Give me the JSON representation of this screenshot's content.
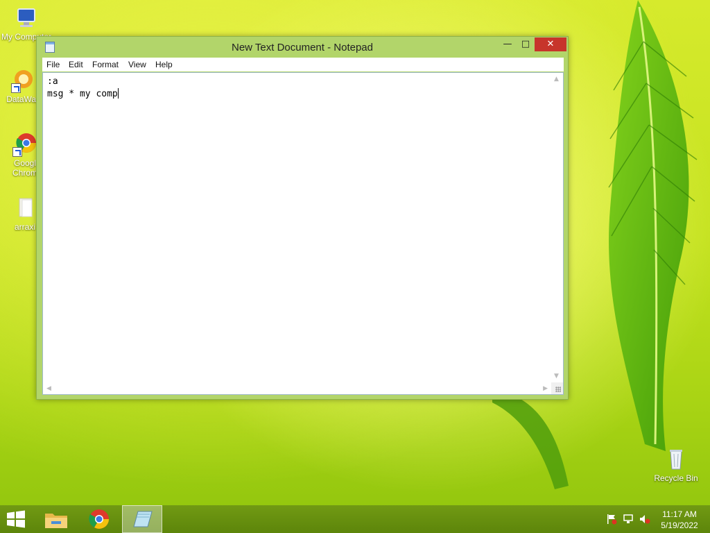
{
  "desktop": {
    "icons": [
      {
        "label": "My Computer",
        "icon": "computer-icon"
      },
      {
        "label": "DataWag",
        "icon": "datawag-shortcut-icon"
      },
      {
        "label": "Googl Chrom",
        "label_line1": "Googl",
        "label_line2": "Chrom",
        "icon": "chrome-shortcut-icon"
      },
      {
        "label": "arraxi",
        "icon": "folder-icon"
      },
      {
        "label": "Recycle Bin",
        "icon": "recycle-bin-icon"
      }
    ]
  },
  "window": {
    "title": "New Text Document - Notepad",
    "controls": {
      "minimize": "—",
      "maximize": "□",
      "close": "✕"
    },
    "menu": [
      "File",
      "Edit",
      "Format",
      "View",
      "Help"
    ],
    "content_lines": [
      ":a",
      "msg * my comp"
    ],
    "accent_color": "#b2d56a"
  },
  "taskbar": {
    "pinned": [
      {
        "name": "start-button",
        "icon": "windows-logo-icon"
      },
      {
        "name": "file-explorer",
        "icon": "folder-icon"
      },
      {
        "name": "google-chrome",
        "icon": "chrome-icon"
      },
      {
        "name": "notepad",
        "icon": "notepad-icon",
        "active": true
      }
    ],
    "tray": {
      "icons": [
        "action-center-flag-icon",
        "network-icon",
        "volume-muted-icon"
      ],
      "time": "11:17 AM",
      "date": "5/19/2022"
    }
  }
}
